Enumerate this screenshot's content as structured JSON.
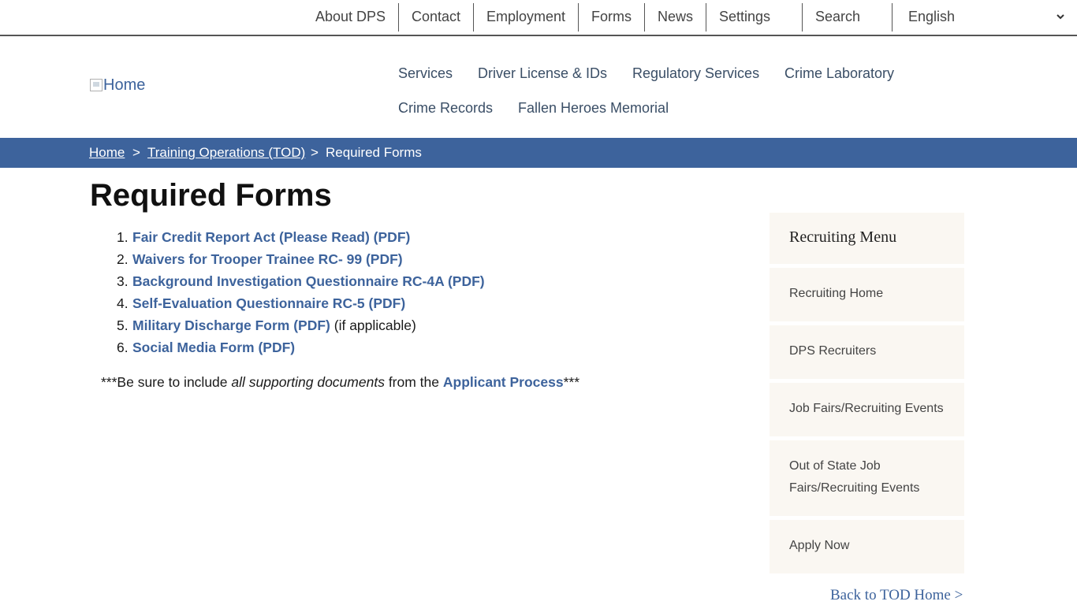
{
  "top_nav": {
    "items": [
      "About DPS",
      "Contact",
      "Employment",
      "Forms",
      "News",
      "Settings",
      "Search"
    ],
    "language": "English",
    "dropdown_icon": "chevron-down-icon"
  },
  "header": {
    "logo_alt": "Home",
    "nav": [
      "Services",
      "Driver License & IDs",
      "Regulatory Services",
      "Crime Laboratory",
      "Crime Records",
      "Fallen Heroes Memorial"
    ]
  },
  "breadcrumb": {
    "items": [
      "Home",
      "Training Operations (TOD)",
      "Required Forms"
    ],
    "separator": ">"
  },
  "page_title": "Required Forms",
  "forms": [
    {
      "num": "1.",
      "label": "Fair Credit Report Act (Please Read) (PDF)",
      "suffix": ""
    },
    {
      "num": "2.",
      "label": "Waivers for Trooper Trainee RC- 99 (PDF)",
      "suffix": ""
    },
    {
      "num": "3.",
      "label": "Background Investigation Questionnaire RC-4A (PDF)",
      "suffix": ""
    },
    {
      "num": "4.",
      "label": "Self-Evaluation Questionnaire RC-5 (PDF)",
      "suffix": ""
    },
    {
      "num": "5.",
      "label": "Military Discharge Form (PDF)",
      "suffix": " (if applicable)"
    },
    {
      "num": "6.",
      "label": "Social Media Form (PDF)",
      "suffix": ""
    }
  ],
  "note": {
    "prefix": "***Be sure to include ",
    "emphasis": "all supporting documents",
    "middle": " from the ",
    "link": "Applicant Process",
    "suffix": "***"
  },
  "sidebar": {
    "title": "Recruiting Menu",
    "items": [
      "Recruiting Home",
      "DPS Recruiters",
      "Job Fairs/Recruiting Events",
      "Out of State Job Fairs/Recruiting Events",
      "Apply Now"
    ],
    "back_link": "Back to TOD Home >"
  },
  "colors": {
    "accent": "#3d639c",
    "sidebar_bg": "#faf7f2"
  }
}
